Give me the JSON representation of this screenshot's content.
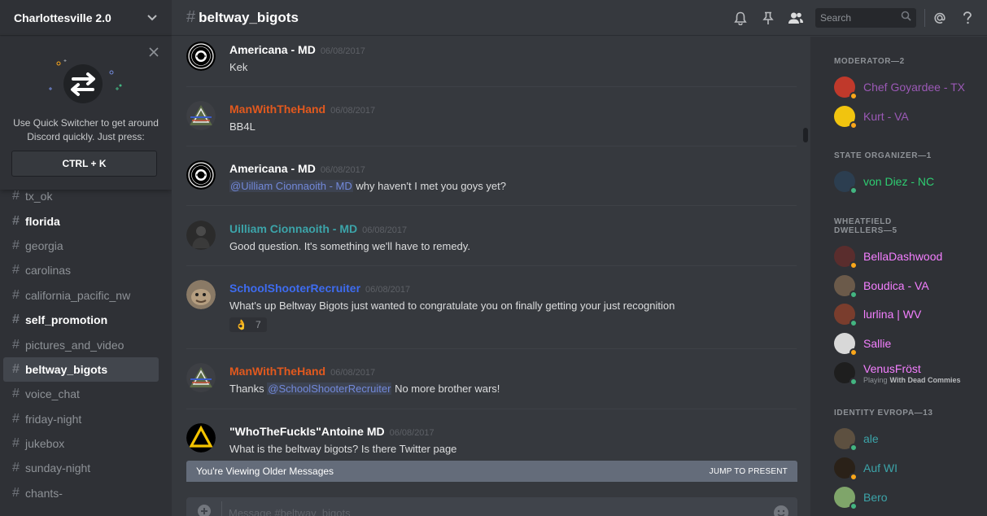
{
  "guild": {
    "name": "Charlottesville 2.0"
  },
  "quick_switcher": {
    "text": "Use Quick Switcher to get around Discord quickly. Just press:",
    "shortcut": "CTRL + K"
  },
  "channels": [
    {
      "name": "tx_ok",
      "state": "muted"
    },
    {
      "name": "florida",
      "state": "unread"
    },
    {
      "name": "georgia",
      "state": "normal"
    },
    {
      "name": "carolinas",
      "state": "normal"
    },
    {
      "name": "california_pacific_nw",
      "state": "normal"
    },
    {
      "name": "self_promotion",
      "state": "unread"
    },
    {
      "name": "pictures_and_video",
      "state": "normal"
    },
    {
      "name": "beltway_bigots",
      "state": "active"
    },
    {
      "name": "voice_chat",
      "state": "normal"
    },
    {
      "name": "friday-night",
      "state": "normal"
    },
    {
      "name": "jukebox",
      "state": "normal"
    },
    {
      "name": "sunday-night",
      "state": "normal"
    },
    {
      "name": "chants-",
      "state": "normal"
    }
  ],
  "header": {
    "channel_name": "beltway_bigots",
    "search_placeholder": "Search",
    "icons": [
      "bell-icon",
      "pin-icon",
      "members-icon",
      "search-icon",
      "mention-icon",
      "help-icon"
    ]
  },
  "messages": [
    {
      "author": "Americana - MD",
      "color": "#ffffff",
      "timestamp": "06/08/2017",
      "parts": [
        {
          "t": "Kek"
        }
      ]
    },
    {
      "author": "ManWithTheHand",
      "color": "#e2591e",
      "timestamp": "06/08/2017",
      "parts": [
        {
          "t": "BB4L"
        }
      ]
    },
    {
      "author": "Americana - MD",
      "color": "#ffffff",
      "timestamp": "06/08/2017",
      "parts": [
        {
          "m": "@Uilliam Cionnaoith - MD"
        },
        {
          "t": " why haven't I met you goys yet?"
        }
      ]
    },
    {
      "author": "Uilliam Cionnaoith - MD",
      "color": "#3ca4a9",
      "timestamp": "06/08/2017",
      "parts": [
        {
          "t": "Good question. It's something we'll have to remedy."
        }
      ]
    },
    {
      "author": "SchoolShooterRecruiter",
      "color": "#3e6cf0",
      "timestamp": "06/08/2017",
      "parts": [
        {
          "t": "What's up Beltway Bigots just wanted to congratulate you on finally getting your just recognition"
        }
      ],
      "reaction": {
        "emoji": "👌",
        "count": "7"
      }
    },
    {
      "author": "ManWithTheHand",
      "color": "#e2591e",
      "timestamp": "06/08/2017",
      "parts": [
        {
          "t": "Thanks "
        },
        {
          "m": "@SchoolShooterRecruiter"
        },
        {
          "t": " No more brother wars!"
        }
      ]
    },
    {
      "author": "\"WhoTheFuckIs\"Antoine MD",
      "color": "#ffffff",
      "timestamp": "06/08/2017",
      "parts": [
        {
          "t": "What is the beltway bigots? Is there Twitter page"
        }
      ]
    }
  ],
  "older_bar": {
    "label": "You're Viewing Older Messages",
    "jump": "JUMP TO PRESENT"
  },
  "composer": {
    "placeholder": "Message #beltway_bigots"
  },
  "member_groups": [
    {
      "title": "MODERATOR—2",
      "members": [
        {
          "name": "Chef Goyardee - TX",
          "color": "#9b59b6",
          "status": "#faa61a"
        },
        {
          "name": "Kurt - VA",
          "color": "#9b59b6",
          "status": "#faa61a"
        }
      ]
    },
    {
      "title": "STATE ORGANIZER—1",
      "members": [
        {
          "name": "von Diez - NC",
          "color": "#2ecc71",
          "status": "#43b581"
        }
      ]
    },
    {
      "title": "WHEATFIELD DWELLERS—5",
      "members": [
        {
          "name": "BellaDashwood",
          "color": "#f47fff",
          "status": "#faa61a"
        },
        {
          "name": "Boudica - VA",
          "color": "#f47fff",
          "status": "#43b581"
        },
        {
          "name": "lurlina | WV",
          "color": "#f47fff",
          "status": "#43b581"
        },
        {
          "name": "Sallie",
          "color": "#f47fff",
          "status": "#faa61a"
        },
        {
          "name": "VenusFröst",
          "color": "#f47fff",
          "status": "#43b581",
          "activity_prefix": "Playing",
          "activity": "With Dead Commies"
        }
      ]
    },
    {
      "title": "IDENTITY EVROPA—13",
      "members": [
        {
          "name": "ale",
          "color": "#3ca4a9",
          "status": "#43b581"
        },
        {
          "name": "Auf WI",
          "color": "#3ca4a9",
          "status": "#faa61a"
        },
        {
          "name": "Bero",
          "color": "#3ca4a9",
          "status": "#43b581"
        }
      ]
    }
  ]
}
